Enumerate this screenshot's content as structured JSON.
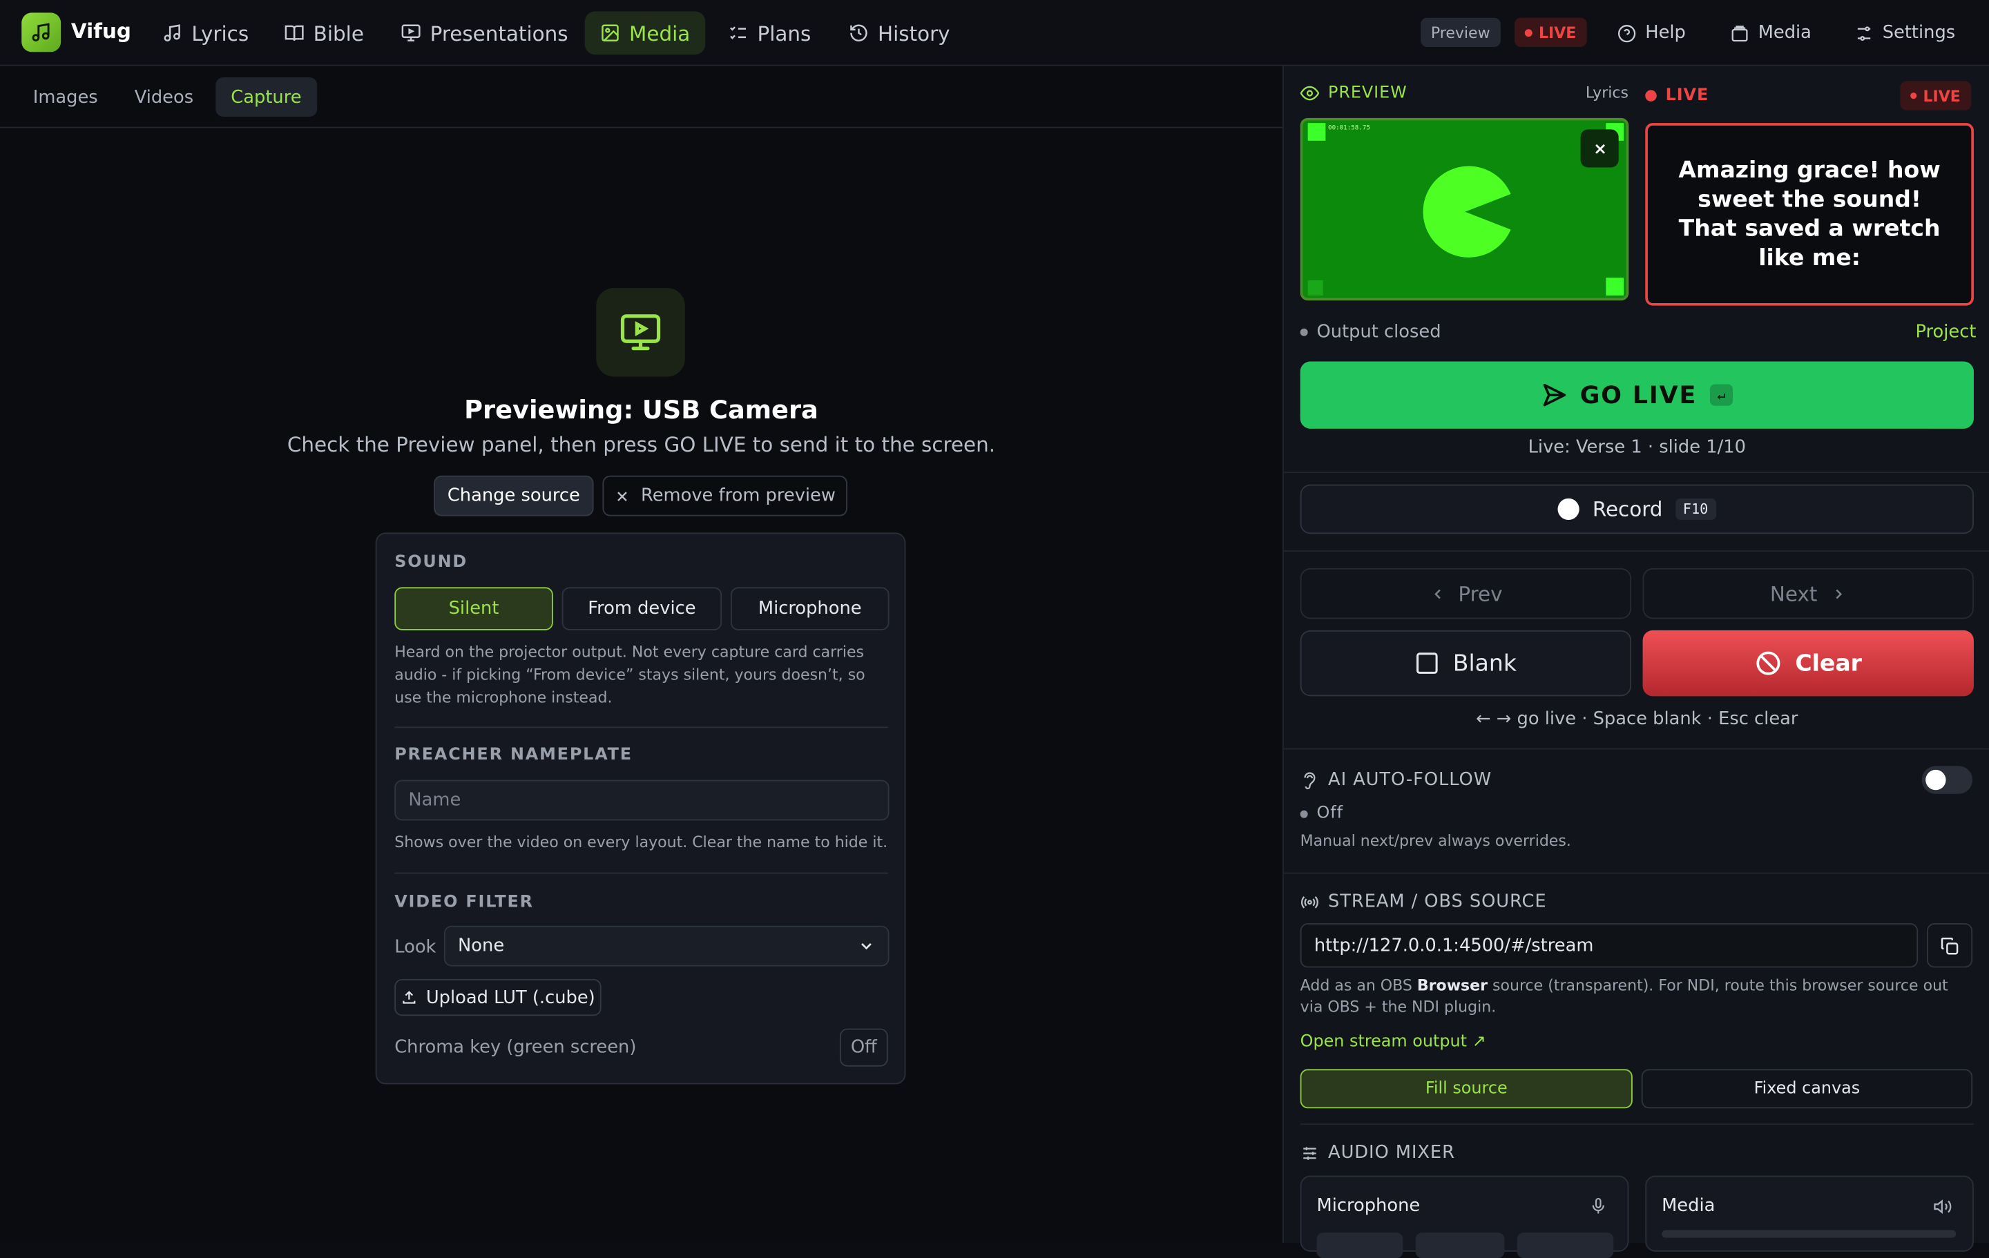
{
  "app": {
    "name": "Vifug"
  },
  "nav": {
    "items": [
      {
        "label": "Lyrics",
        "icon": "music-note-icon"
      },
      {
        "label": "Bible",
        "icon": "book-icon"
      },
      {
        "label": "Presentations",
        "icon": "presentation-icon"
      },
      {
        "label": "Media",
        "icon": "image-icon",
        "active": true
      },
      {
        "label": "Plans",
        "icon": "checklist-icon"
      },
      {
        "label": "History",
        "icon": "history-icon"
      }
    ],
    "preview_pill": "Preview",
    "live_pill": "LIVE",
    "help": "Help",
    "media": "Media",
    "settings": "Settings"
  },
  "subtabs": [
    "Images",
    "Videos",
    "Capture"
  ],
  "capture": {
    "title": "Previewing: USB Camera",
    "subtitle": "Check the Preview panel, then press GO LIVE to send it to the screen.",
    "change_source": "Change source",
    "remove_from_preview": "Remove from preview",
    "sound": {
      "heading": "SOUND",
      "options": [
        "Silent",
        "From device",
        "Microphone"
      ],
      "selected": "Silent",
      "help": "Heard on the projector output. Not every capture card carries audio - if picking “From device” stays silent, yours doesn’t, so use the microphone instead."
    },
    "nameplate": {
      "heading": "PREACHER NAMEPLATE",
      "placeholder": "Name",
      "help": "Shows over the video on every layout. Clear the name to hide it."
    },
    "filter": {
      "heading": "VIDEO FILTER",
      "look_label": "Look",
      "look_value": "None",
      "upload_lut": "Upload LUT (.cube)",
      "chroma_label": "Chroma key (green screen)",
      "chroma_state": "Off"
    }
  },
  "panel": {
    "preview_label": "PREVIEW",
    "lyrics_label": "Lyrics",
    "live_label": "LIVE",
    "live_badge": "LIVE",
    "preview_timestamp": "00:01:58.75",
    "live_text": "Amazing grace! how sweet the sound! That saved a wretch like me:",
    "output_status": "Output closed",
    "project": "Project",
    "go_live": "GO LIVE",
    "go_live_key": "↵",
    "live_info": "Live: Verse 1 · slide 1/10",
    "record": "Record",
    "record_key": "F10",
    "prev": "Prev",
    "next": "Next",
    "blank": "Blank",
    "clear": "Clear",
    "shortcuts": "← → go live · Space blank · Esc clear",
    "ai": {
      "heading": "AI AUTO-FOLLOW",
      "status": "Off",
      "help": "Manual next/prev always overrides."
    },
    "stream": {
      "heading": "STREAM / OBS SOURCE",
      "url": "http://127.0.0.1:4500/#/stream",
      "help_pre": "Add as an OBS ",
      "help_bold": "Browser",
      "help_post": " source (transparent). For NDI, route this browser source out via OBS + the NDI plugin.",
      "open_link": "Open stream output ↗",
      "modes": [
        "Fill source",
        "Fixed canvas"
      ],
      "selected_mode": "Fill source"
    },
    "mixer": {
      "heading": "AUDIO MIXER",
      "channels": [
        "Microphone",
        "Media"
      ]
    }
  },
  "colors": {
    "accent": "#9be34a",
    "live_red": "#ef4444",
    "go_green": "#22c55e",
    "background": "#0b0d12"
  }
}
